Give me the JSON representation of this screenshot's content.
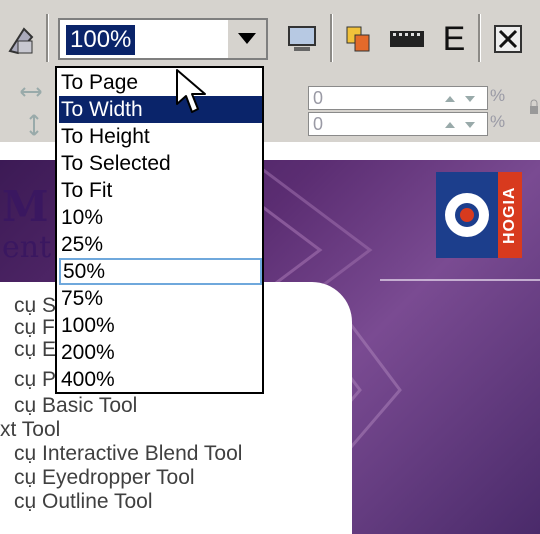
{
  "toolbar": {
    "zoom_value": "100%",
    "text_tool_glyph": "E",
    "icons": [
      "printer-icon",
      "monitor-icon",
      "copy-icon",
      "film-icon",
      "text-icon",
      "close-box-icon"
    ]
  },
  "propbar": {
    "field1_value": "0",
    "field2_value": "0",
    "pct1": "%",
    "pct2": "%"
  },
  "zoom_menu": {
    "items": [
      "To Page",
      "To Width",
      "To Height",
      "To Selected",
      "To Fit",
      "10%",
      "25%",
      "50%",
      "75%",
      "100%",
      "200%",
      "400%"
    ],
    "hovered_index": 1,
    "selected_index": 7
  },
  "slide": {
    "title_line1": "M",
    "title_line2": "ent",
    "logo_text": "HOGIA",
    "colors": {
      "purple_dark": "#3c1a55",
      "logo_red": "#d83a1e",
      "logo_blue": "#1c3e8c"
    }
  },
  "tools": [
    "cụ S",
    "cụ F",
    "cụ E",
    "cụ Polygon Tool",
    "cụ Basic Tool",
    "xt Tool",
    "cụ Interactive Blend Tool",
    "cụ Eyedropper Tool",
    "cụ Outline Tool"
  ]
}
